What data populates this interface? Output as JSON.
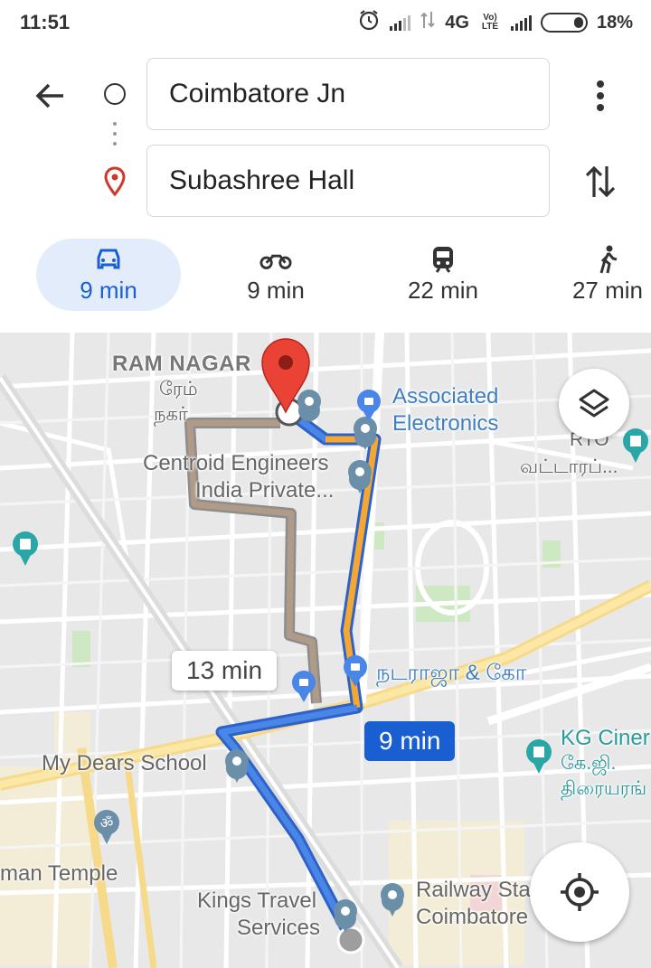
{
  "status_bar": {
    "time": "11:51",
    "network": "4G",
    "volte": "Vo) LTE",
    "battery": "18%"
  },
  "header": {
    "back_icon": "arrow-left-icon",
    "origin": "Coimbatore Jn",
    "destination": "Subashree Hall",
    "more_icon": "more-vert-icon",
    "swap_icon": "swap-vert-icon"
  },
  "modes": [
    {
      "icon": "car-icon",
      "time": "9 min",
      "selected": true
    },
    {
      "icon": "motorbike-icon",
      "time": "9 min",
      "selected": false
    },
    {
      "icon": "train-icon",
      "time": "22 min",
      "selected": false
    },
    {
      "icon": "walk-icon",
      "time": "27 min",
      "selected": false
    }
  ],
  "map": {
    "labels": {
      "ram_nagar": "RAM NAGAR",
      "ram_nagar_ta1": "ரேம்",
      "ram_nagar_ta2": "நகர்",
      "associated1": "Associated",
      "associated2": "Electronics",
      "rto": "RTO",
      "rto_ta": "வட்டாரப்...",
      "centroid1": "Centroid Engineers",
      "centroid2": "India Private...",
      "natraja": "நடராஜா & கோ",
      "kg1": "KG Ciner",
      "kg2": "கே.ஜி.",
      "kg3": "திரையரங்",
      "my_dears": "My Dears School",
      "temple": "man Temple",
      "kings1": "Kings Travel",
      "kings2": "Services",
      "railway1": "Railway Sta",
      "railway2": "Coimbatore"
    },
    "route_alt_time": "13 min",
    "route_main_time": "9 min",
    "route_colors": {
      "main": "#4a86e8",
      "traffic": "#f4a733",
      "alt": "#b09a88"
    },
    "layers_icon": "layers-icon",
    "locate_icon": "my-location-icon"
  }
}
